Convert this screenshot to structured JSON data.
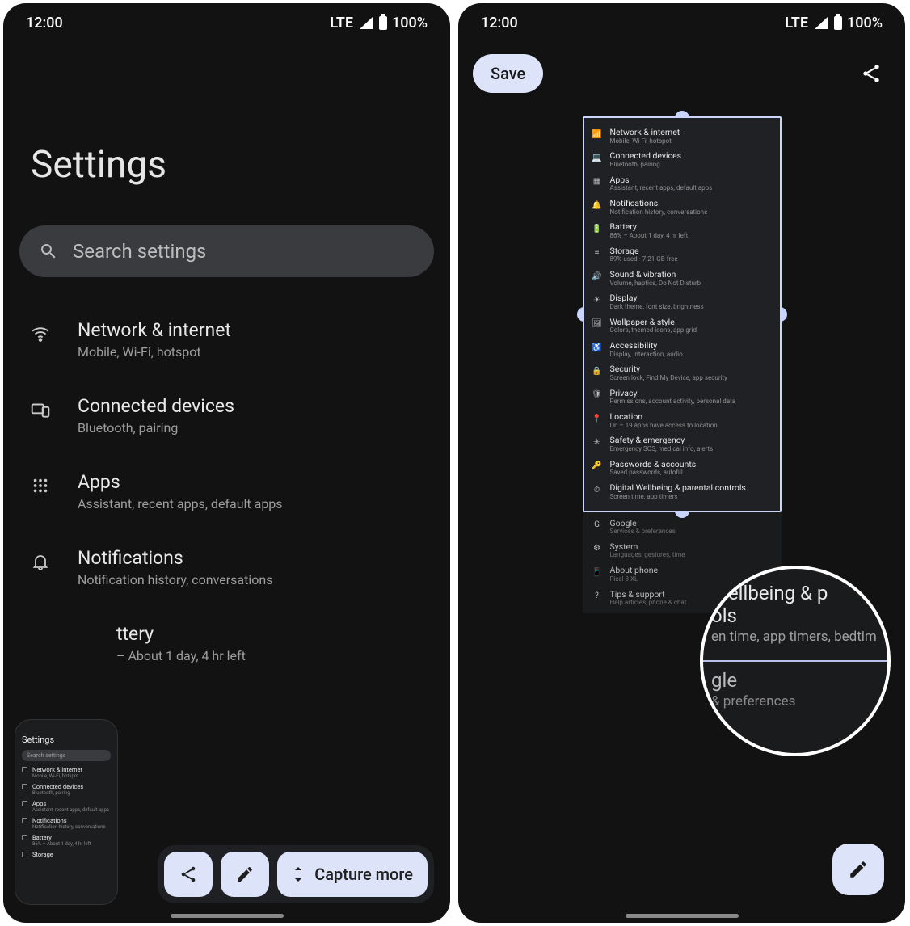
{
  "status": {
    "time": "12:00",
    "net": "LTE",
    "battery": "100%"
  },
  "screen1": {
    "title": "Settings",
    "search_placeholder": "Search settings",
    "items": [
      {
        "title": "Network & internet",
        "sub": "Mobile, Wi-Fi, hotspot"
      },
      {
        "title": "Connected devices",
        "sub": "Bluetooth, pairing"
      },
      {
        "title": "Apps",
        "sub": "Assistant, recent apps, default apps"
      },
      {
        "title": "Notifications",
        "sub": "Notification history, conversations"
      },
      {
        "title": "Battery",
        "title_visible": "ttery",
        "sub": "– About 1 day, 4 hr left"
      }
    ],
    "preview": {
      "title": "Settings",
      "search": "Search settings",
      "rows": [
        {
          "a": "Network & internet",
          "b": "Mobile, Wi-Fi, hotspot"
        },
        {
          "a": "Connected devices",
          "b": "Bluetooth, pairing"
        },
        {
          "a": "Apps",
          "b": "Assistant, recent apps, default apps"
        },
        {
          "a": "Notifications",
          "b": "Notification history, conversations"
        },
        {
          "a": "Battery",
          "b": "86% – About 1 day, 4 hr left"
        },
        {
          "a": "Storage",
          "b": ""
        }
      ]
    },
    "actions": {
      "capture_more": "Capture more"
    }
  },
  "screen2": {
    "save": "Save",
    "inside_crop": [
      {
        "a": "Network & internet",
        "b": "Mobile, Wi-Fi, hotspot"
      },
      {
        "a": "Connected devices",
        "b": "Bluetooth, pairing"
      },
      {
        "a": "Apps",
        "b": "Assistant, recent apps, default apps"
      },
      {
        "a": "Notifications",
        "b": "Notification history, conversations"
      },
      {
        "a": "Battery",
        "b": "86% – About 1 day, 4 hr left"
      },
      {
        "a": "Storage",
        "b": "89% used · 7.21 GB free"
      },
      {
        "a": "Sound & vibration",
        "b": "Volume, haptics, Do Not Disturb"
      },
      {
        "a": "Display",
        "b": "Dark theme, font size, brightness"
      },
      {
        "a": "Wallpaper & style",
        "b": "Colors, themed icons, app grid"
      },
      {
        "a": "Accessibility",
        "b": "Display, interaction, audio"
      },
      {
        "a": "Security",
        "b": "Screen lock, Find My Device, app security"
      },
      {
        "a": "Privacy",
        "b": "Permissions, account activity, personal data"
      },
      {
        "a": "Location",
        "b": "On – 19 apps have access to location"
      },
      {
        "a": "Safety & emergency",
        "b": "Emergency SOS, medical info, alerts"
      },
      {
        "a": "Passwords & accounts",
        "b": "Saved passwords, autofill"
      },
      {
        "a": "Digital Wellbeing & parental controls",
        "b": "Screen time, app timers"
      }
    ],
    "below_crop": [
      {
        "a": "Google",
        "b": "Services & preferences"
      },
      {
        "a": "System",
        "b": "Languages, gestures, time"
      },
      {
        "a": "About phone",
        "b": "Pixel 3 XL"
      },
      {
        "a": "Tips & support",
        "b": "Help articles, phone & chat"
      }
    ],
    "magnifier": {
      "l1": "Wellbeing & p",
      "l1b": "ols",
      "l2": "en time, app timers, bedtim",
      "g1": "gle",
      "g2": "& preferences"
    }
  }
}
